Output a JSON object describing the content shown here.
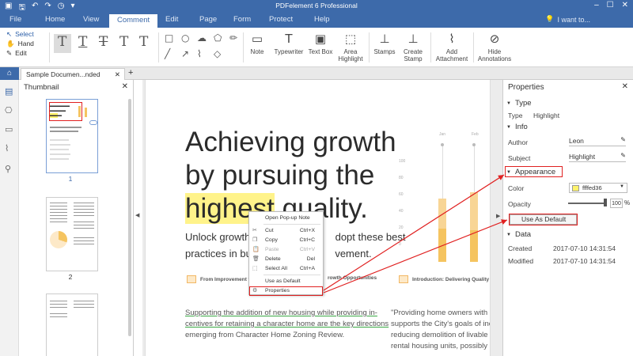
{
  "titlebar": {
    "title": "PDFelement 6 Professional"
  },
  "menu": {
    "items": [
      "File",
      "Home",
      "View",
      "Comment",
      "Edit",
      "Page",
      "Form",
      "Protect",
      "Help"
    ],
    "active": "Comment",
    "search_placeholder": "I want to..."
  },
  "ribbon": {
    "modes": {
      "select": "Select",
      "hand": "Hand",
      "edit": "Edit"
    },
    "buttons": {
      "note": "Note",
      "typewriter": "Typewriter",
      "textbox": "Text Box",
      "area_highlight_1": "Area",
      "area_highlight_2": "Highlight",
      "stamps": "Stamps",
      "create_stamp_1": "Create",
      "create_stamp_2": "Stamp",
      "add_attachment_1": "Add",
      "add_attachment_2": "Attachment",
      "hide_annotations_1": "Hide",
      "hide_annotations_2": "Annotations"
    }
  },
  "tabs": {
    "doc_tab": "Sample Documen...nded"
  },
  "thumbnail_panel": {
    "title": "Thumbnail",
    "pages": [
      "1",
      "2"
    ]
  },
  "document": {
    "headline_1": "Achieving growth",
    "headline_2": "by pursuing the",
    "headline_3_hl": "highest",
    "headline_3_rest": " quality.",
    "sub_1": "Unlock growth f",
    "sub_1_r": "dopt these best",
    "sub_2": "practices in bus",
    "sub_2_r": "vement.",
    "sec1": "From Improvement to",
    "sec2": "rowth Opportunities",
    "sec3": "Introduction: Delivering Quality",
    "body_l_1": "Supporting the addition of new housing while providing in-",
    "body_l_2": "centives for retaining a character home are the key directions",
    "body_l_3": "emerging from Character Home Zoning Review.",
    "body_r_1": "\"Providing home owners with the",
    "body_r_2": "supports the City's goals of increa",
    "body_r_3": "reducing demolition of livable hom",
    "body_r_4": "rental housing units, possibly ove",
    "chart_header_1": "Jan",
    "chart_header_2": "Feb",
    "chart_axis": [
      "100",
      "80",
      "60",
      "40",
      "20",
      "0"
    ]
  },
  "context_menu": {
    "open_popup": "Open Pop-up Note",
    "cut": "Cut",
    "cut_sc": "Ctrl+X",
    "copy": "Copy",
    "copy_sc": "Ctrl+C",
    "paste": "Paste",
    "paste_sc": "Ctrl+V",
    "delete": "Delete",
    "delete_sc": "Del",
    "select_all": "Select All",
    "select_all_sc": "Ctrl+A",
    "use_default": "Use as Default",
    "properties": "Properties"
  },
  "properties": {
    "title": "Properties",
    "type_section": "Type",
    "type_label": "Type",
    "type_value": "Highlight",
    "info_section": "Info",
    "author_label": "Author",
    "author_value": "Leon",
    "subject_label": "Subject",
    "subject_value": "Highlight",
    "appearance_section": "Appearance",
    "color_label": "Color",
    "color_value": "ffffed36",
    "opacity_label": "Opacity",
    "opacity_value": "100",
    "opacity_unit": "%",
    "use_default_button": "Use As Default",
    "data_section": "Data",
    "created_label": "Created",
    "created_value": "2017-07-10 14:31:54",
    "modified_label": "Modified",
    "modified_value": "2017-07-10 14:31:54"
  },
  "colors": {
    "accent": "#3d6aaa",
    "highlight": "#fff38a",
    "callout": "#e02020",
    "chart_bar": "#f8d595"
  }
}
